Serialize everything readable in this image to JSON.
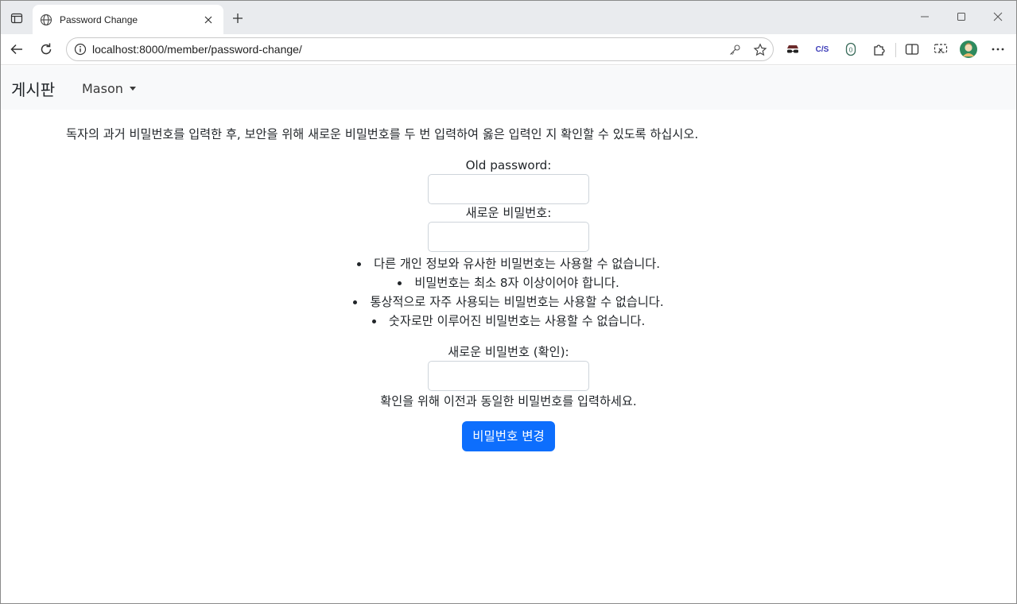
{
  "browser": {
    "tab_title": "Password Change",
    "url": "localhost:8000/member/password-change/",
    "extension_label": "C/S"
  },
  "navbar": {
    "brand": "게시판",
    "user": "Mason"
  },
  "content": {
    "instruction": "독자의 과거 비밀번호를 입력한 후, 보안을 위해 새로운 비밀번호를 두 번 입력하여 옳은 입력인 지 확인할 수 있도록 하십시오.",
    "old_password_label": "Old password:",
    "new_password_label": "새로운 비밀번호:",
    "password_rules": [
      "다른 개인 정보와 유사한 비밀번호는 사용할 수 없습니다.",
      "비밀번호는 최소 8자 이상이어야 합니다.",
      "통상적으로 자주 사용되는 비밀번호는 사용할 수 없습니다.",
      "숫자로만 이루어진 비밀번호는 사용할 수 없습니다."
    ],
    "confirm_label": "새로운 비밀번호 (확인):",
    "confirm_help": "확인을 위해 이전과 동일한 비밀번호를 입력하세요.",
    "submit_label": "비밀번호 변경"
  },
  "colors": {
    "primary_button": "#0d6efd",
    "navbar_bg": "#f8f9fa"
  }
}
